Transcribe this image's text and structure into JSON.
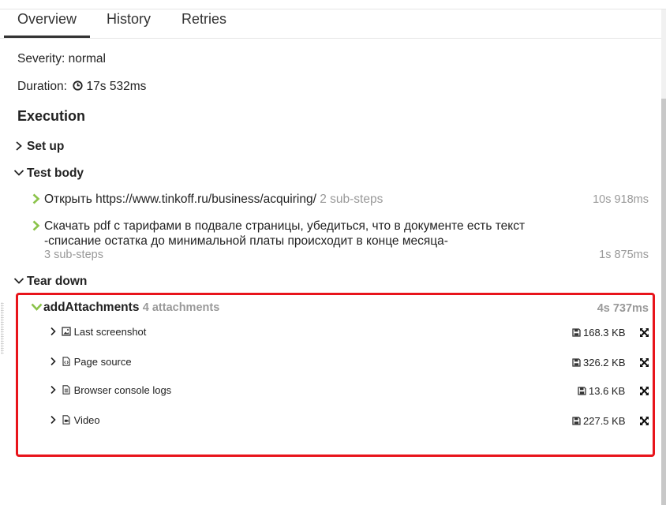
{
  "tabs": {
    "overview": "Overview",
    "history": "History",
    "retries": "Retries"
  },
  "info": {
    "severity": "Severity: normal",
    "duration_label": "Duration:",
    "duration_value": "17s 532ms"
  },
  "execution": {
    "heading": "Execution",
    "setup_label": "Set up",
    "test_body_label": "Test body",
    "tear_down_label": "Tear down"
  },
  "test_body": {
    "step1": {
      "text": "Открыть https://www.tinkoff.ru/business/acquiring/",
      "substeps": "2 sub-steps",
      "duration": "10s 918ms"
    },
    "step2": {
      "line1": "Скачать pdf с тарифами в подвале страницы, убедиться, что в документе есть текст",
      "line2": "-списание остатка до минимальной платы происходит в конце месяца-",
      "substeps": "3 sub-steps",
      "duration": "1s 875ms"
    }
  },
  "tear_down": {
    "name": "addAttachments",
    "count": "4 attachments",
    "duration": "4s 737ms",
    "attachments": [
      {
        "name": "Last screenshot",
        "icon": "image-file-icon",
        "size": "168.3 KB"
      },
      {
        "name": "Page source",
        "icon": "code-file-icon",
        "size": "326.2 KB"
      },
      {
        "name": "Browser console logs",
        "icon": "text-file-icon",
        "size": "13.6 KB"
      },
      {
        "name": "Video",
        "icon": "video-file-icon",
        "size": "227.5 KB"
      }
    ]
  },
  "colors": {
    "highlight_box": "#e8141b",
    "step_chevron": "#8bc34a",
    "muted_text": "#999999"
  }
}
